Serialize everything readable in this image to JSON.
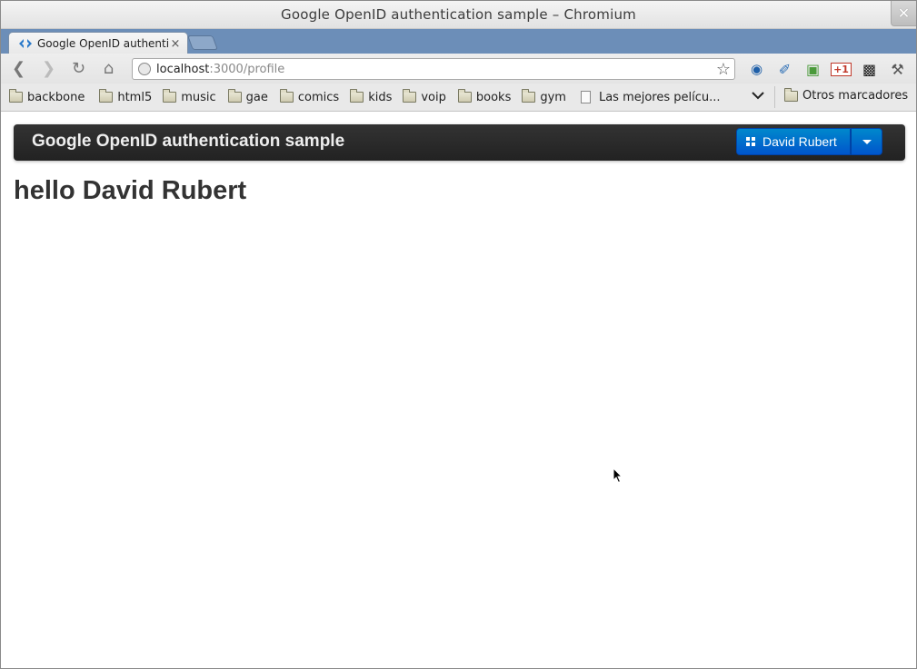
{
  "window": {
    "title": "Google OpenID authentication sample – Chromium",
    "close_glyph": "✕"
  },
  "tabs": [
    {
      "title": "Google OpenID authentica",
      "close_glyph": "×",
      "active": true
    }
  ],
  "toolbar": {
    "back_glyph": "❮",
    "forward_glyph": "❯",
    "reload_glyph": "↻",
    "home_glyph": "⌂",
    "url_host": "localhost",
    "url_path": ":3000/profile",
    "star_glyph": "☆",
    "extensions": [
      {
        "name": "globe-extension-icon",
        "glyph": "◉",
        "color": "#1f5fa8"
      },
      {
        "name": "eyedropper-extension-icon",
        "glyph": "✐",
        "color": "#2a6db5"
      },
      {
        "name": "evernote-clip-extension-icon",
        "glyph": "▣",
        "color": "#4a9a3a"
      },
      {
        "name": "google-plus-one-extension-icon",
        "glyph": "+1",
        "color": "#c0392b"
      },
      {
        "name": "evernote-extension-icon",
        "glyph": "▩",
        "color": "#222222"
      },
      {
        "name": "wrench-menu-icon",
        "glyph": "⚒",
        "color": "#555555"
      }
    ]
  },
  "bookmarks": {
    "items": [
      {
        "label": "backbone",
        "kind": "folder"
      },
      {
        "label": "html5",
        "kind": "folder"
      },
      {
        "label": "music",
        "kind": "folder"
      },
      {
        "label": "gae",
        "kind": "folder"
      },
      {
        "label": "comics",
        "kind": "folder"
      },
      {
        "label": "kids",
        "kind": "folder"
      },
      {
        "label": "voip",
        "kind": "folder"
      },
      {
        "label": "books",
        "kind": "folder"
      },
      {
        "label": "gym",
        "kind": "folder"
      },
      {
        "label": "Las mejores pelícu...",
        "kind": "page"
      }
    ],
    "overflow_glyph": "⌵",
    "other_label": "Otros marcadores"
  },
  "page": {
    "brand": "Google OpenID authentication sample",
    "user_button_label": "David Rubert",
    "greeting": "hello David Rubert"
  },
  "colors": {
    "tabstrip": "#6c8eb8",
    "navbar": "#222222",
    "primary_button": "#0074cc"
  }
}
